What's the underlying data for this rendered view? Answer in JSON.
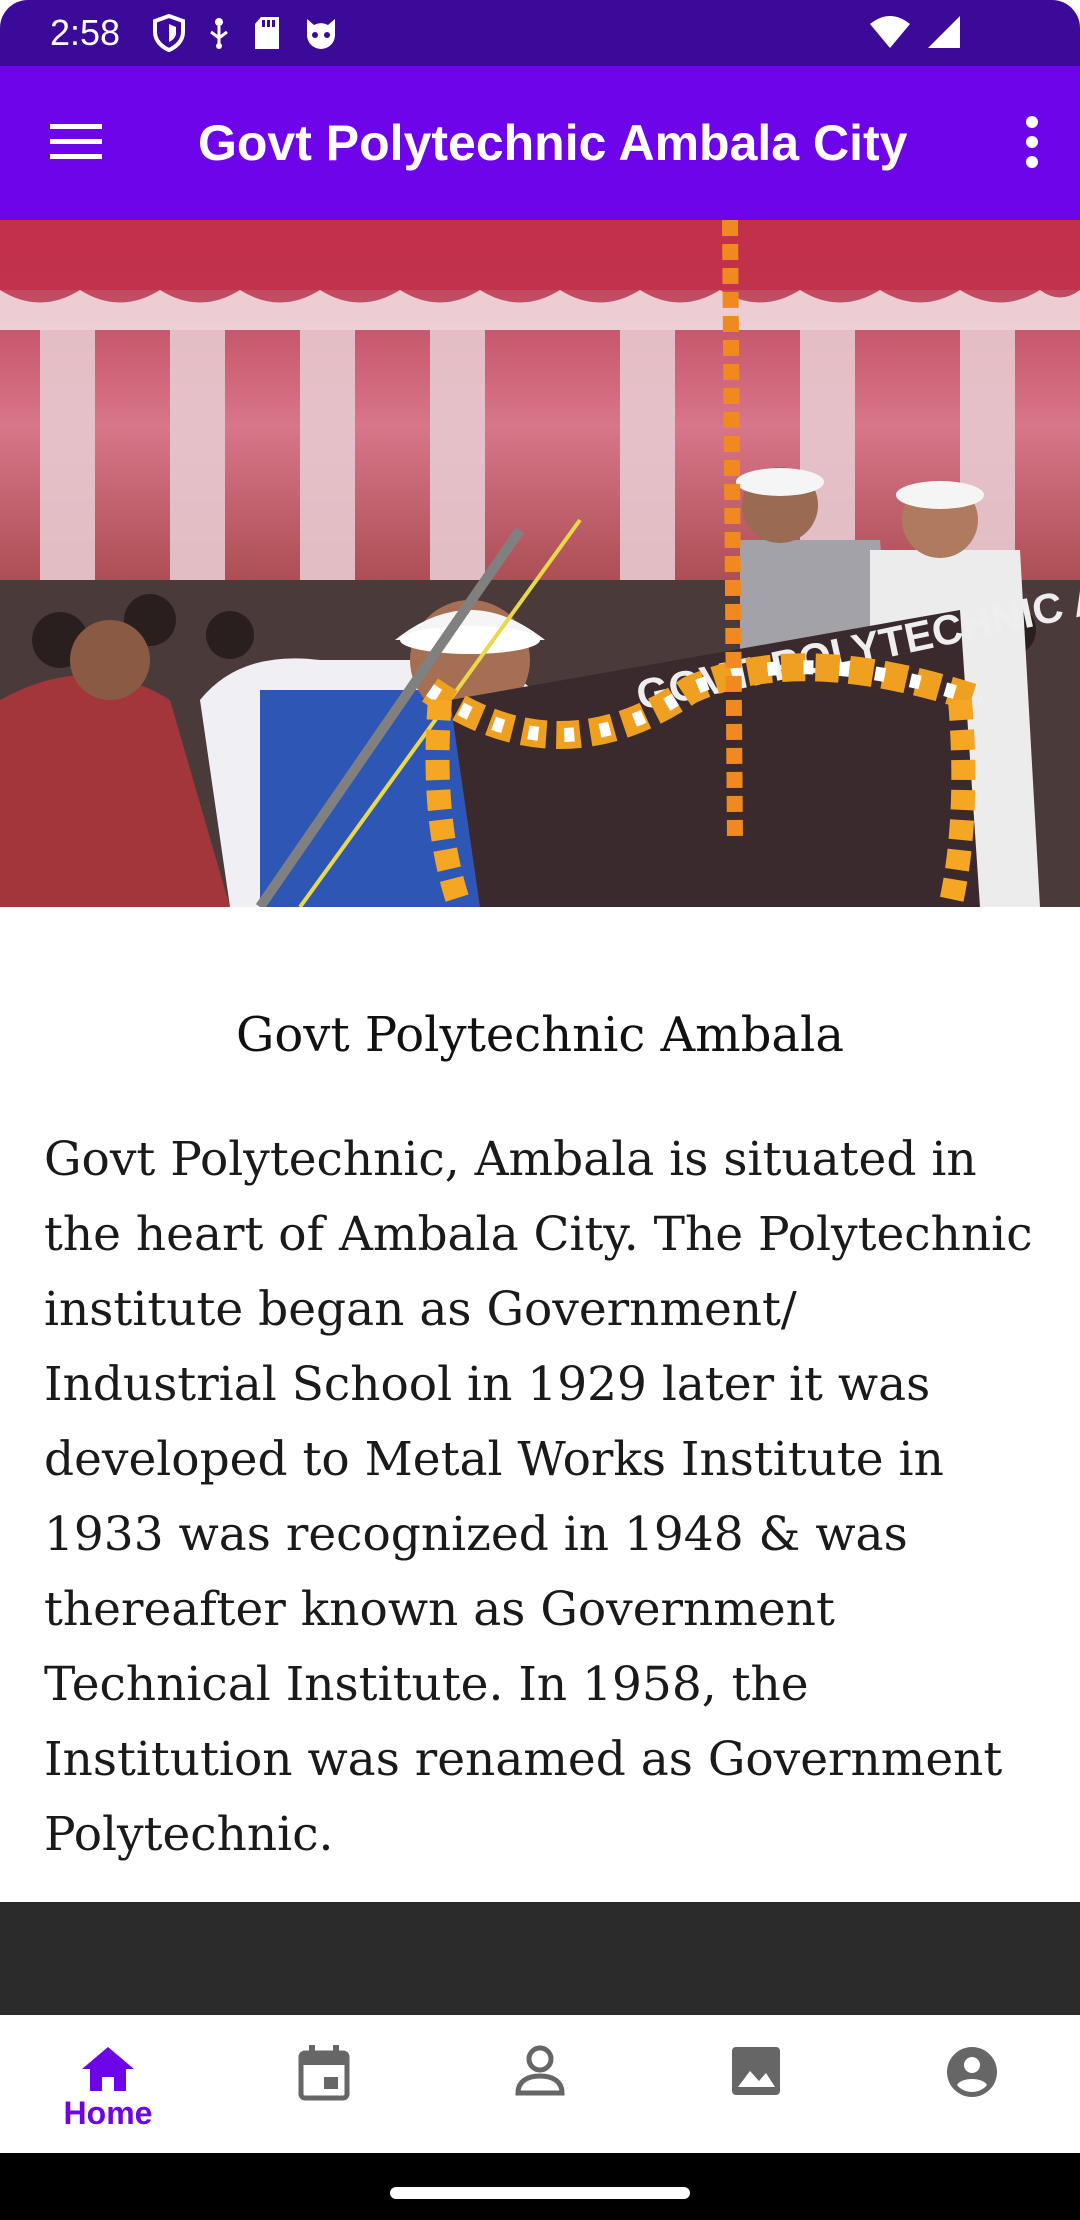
{
  "status_bar": {
    "time": "2:58",
    "left_icons": [
      "shield-icon",
      "usb-icon",
      "sd-card-icon",
      "cat-face-icon"
    ],
    "right_icons": [
      "wifi-icon",
      "signal-icon"
    ]
  },
  "app_bar": {
    "title": "Govt Polytechnic Ambala City",
    "menu_icon": "hamburger-menu-icon",
    "overflow_icon": "more-vert-icon",
    "color": "#6d04ea"
  },
  "hero": {
    "photo_sign_text": "GOVT. POLYTECHNIC AMBALA"
  },
  "content": {
    "title": "Govt Polytechnic Ambala",
    "body": "Govt Polytechnic, Ambala is situated in the heart of Ambala City. The Polytechnic institute began as Government/ Industrial School in 1929 later it was developed to Metal Works Institute in 1933 was recognized in 1948 & was thereafter known as Government Technical Institute. In 1958, the Institution was renamed as Government Polytechnic."
  },
  "bottom_nav": {
    "items": [
      {
        "label": "Home",
        "icon": "home-icon",
        "active": true
      },
      {
        "label": "",
        "icon": "calendar-icon",
        "active": false
      },
      {
        "label": "",
        "icon": "person-icon",
        "active": false
      },
      {
        "label": "",
        "icon": "image-icon",
        "active": false
      },
      {
        "label": "",
        "icon": "account-circle-icon",
        "active": false
      }
    ],
    "active_color": "#6d04ea",
    "inactive_color": "#666666"
  }
}
